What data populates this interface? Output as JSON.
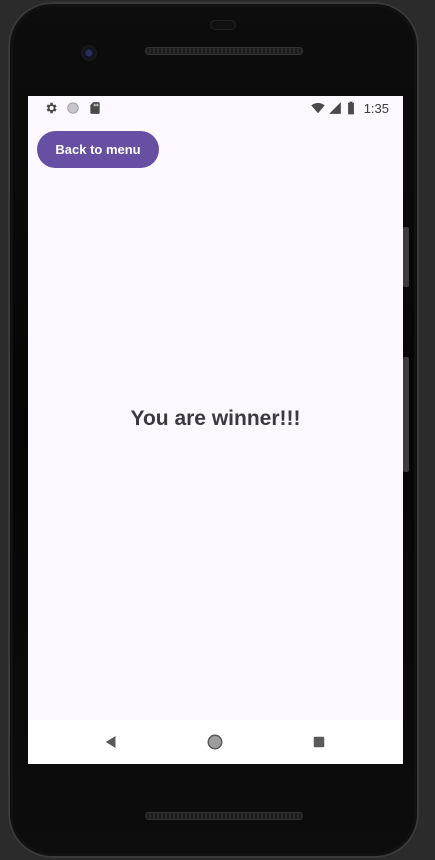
{
  "status_bar": {
    "time": "1:35",
    "icons": [
      "gear-icon",
      "circle-icon",
      "sd-card-icon",
      "wifi-icon",
      "signal-icon",
      "battery-icon"
    ]
  },
  "app": {
    "back_button_label": "Back to menu",
    "message": "You are winner!!!"
  },
  "colors": {
    "primary": "#6750a4",
    "background": "#fdf7ff",
    "text": "#3b3a40"
  },
  "nav_bar": {
    "icons": [
      "back-triangle-icon",
      "home-circle-icon",
      "recents-square-icon"
    ]
  }
}
